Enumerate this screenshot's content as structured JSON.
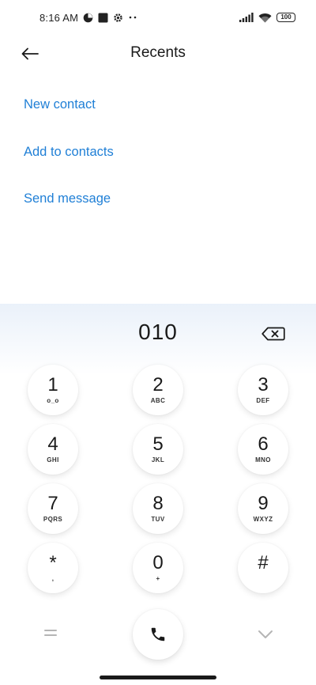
{
  "status_bar": {
    "time": "8:16 AM",
    "battery": "100",
    "icons": [
      "app-notification-icon",
      "square-notification-icon",
      "gear-icon",
      "more-dots-icon",
      "signal-icon",
      "wifi-icon",
      "battery-icon"
    ]
  },
  "header": {
    "title": "Recents",
    "back_icon": "arrow-left-icon"
  },
  "options": [
    {
      "label": "New contact"
    },
    {
      "label": "Add to contacts"
    },
    {
      "label": "Send message"
    }
  ],
  "dialer": {
    "number": "010",
    "backspace_icon": "backspace-icon",
    "keys": [
      {
        "digit": "1",
        "letters": "o_o"
      },
      {
        "digit": "2",
        "letters": "ABC"
      },
      {
        "digit": "3",
        "letters": "DEF"
      },
      {
        "digit": "4",
        "letters": "GHI"
      },
      {
        "digit": "5",
        "letters": "JKL"
      },
      {
        "digit": "6",
        "letters": "MNO"
      },
      {
        "digit": "7",
        "letters": "PQRS"
      },
      {
        "digit": "8",
        "letters": "TUV"
      },
      {
        "digit": "9",
        "letters": "WXYZ"
      },
      {
        "digit": "*",
        "letters": ","
      },
      {
        "digit": "0",
        "letters": "+"
      },
      {
        "digit": "#",
        "letters": ""
      }
    ],
    "menu_icon": "menu-lines-icon",
    "call_icon": "phone-icon",
    "collapse_icon": "chevron-down-icon"
  },
  "colors": {
    "accent": "#1f7fd6",
    "text": "#1a1a1a",
    "dialer_gradient_top": "#eaf1fa"
  }
}
